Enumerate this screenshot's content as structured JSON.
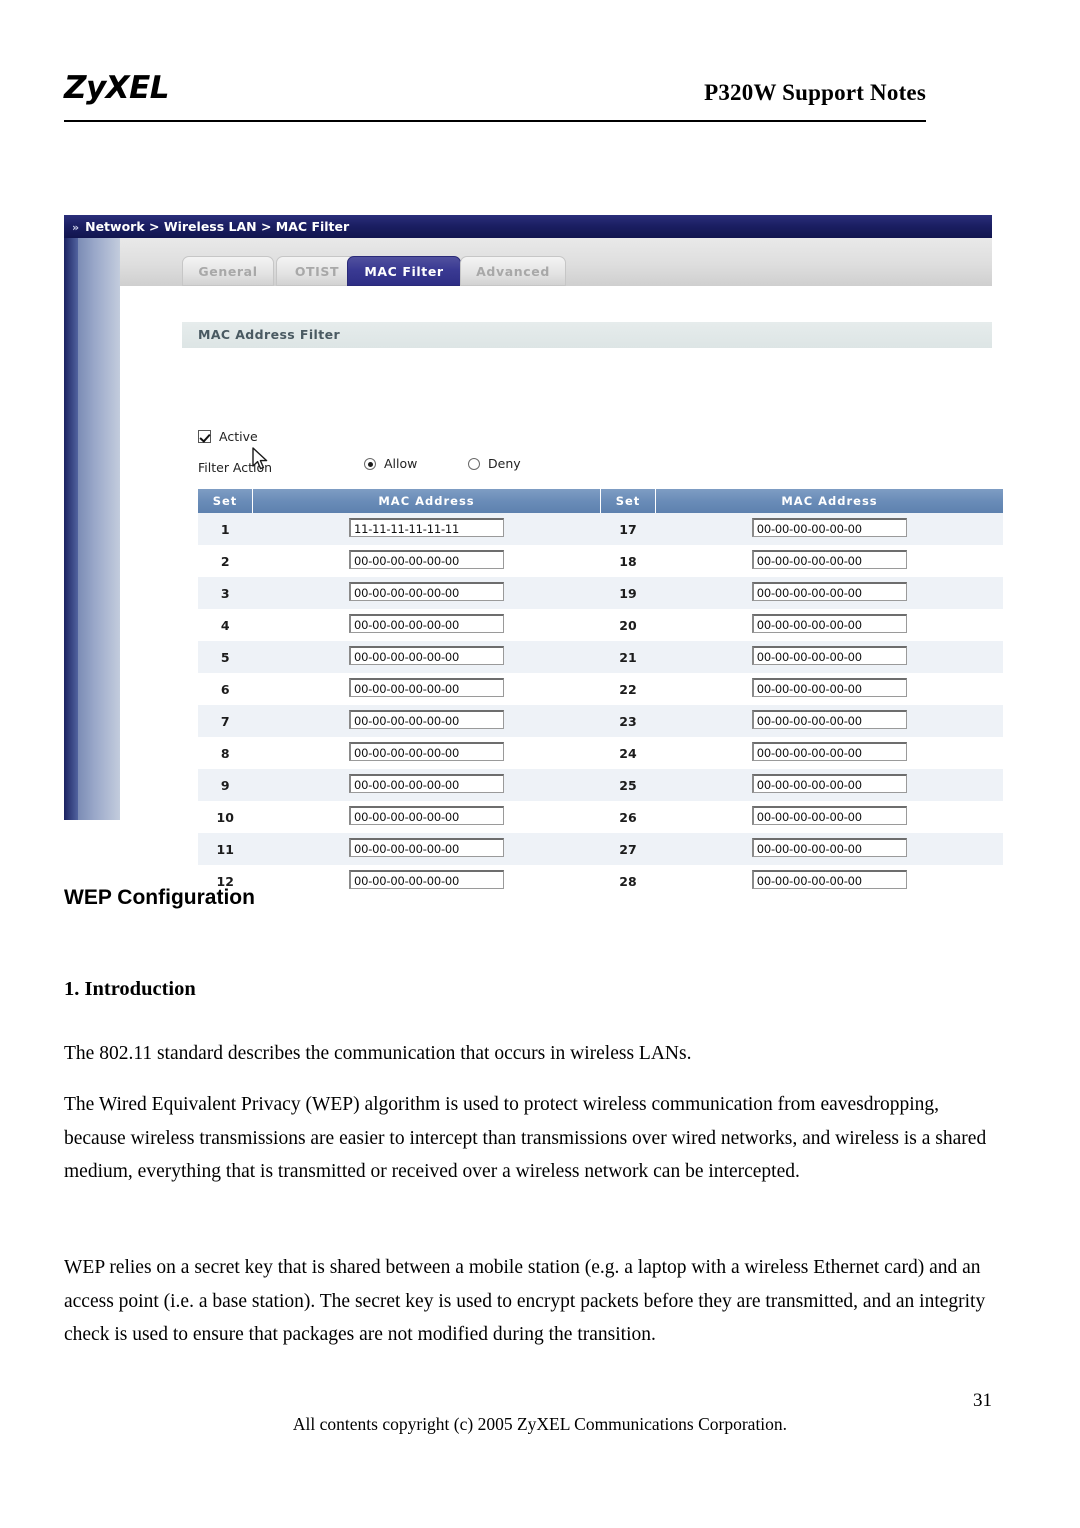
{
  "page": {
    "logo_text": "ZyXEL",
    "header_title": "P320W Support Notes",
    "page_number": "31",
    "footer_copyright": "All contents copyright (c) 2005 ZyXEL Communications Corporation."
  },
  "router_ui": {
    "breadcrumb": "Network > Wireless LAN > MAC Filter",
    "breadcrumb_arrow": "»",
    "tabs": [
      {
        "label": "General",
        "active": false
      },
      {
        "label": "OTIST",
        "active": false
      },
      {
        "label": "MAC Filter",
        "active": true
      },
      {
        "label": "Advanced",
        "active": false
      }
    ],
    "section_title": "MAC Address Filter",
    "active_checkbox": {
      "label": "Active",
      "checked": true
    },
    "filter_action": {
      "label": "Filter Action",
      "options": [
        {
          "label": "Allow",
          "selected": true
        },
        {
          "label": "Deny",
          "selected": false
        }
      ]
    },
    "table": {
      "headers": [
        "Set",
        "MAC Address",
        "Set",
        "MAC Address"
      ],
      "rows": [
        {
          "set_left": "1",
          "mac_left": "11-11-11-11-11-11",
          "set_right": "17",
          "mac_right": "00-00-00-00-00-00"
        },
        {
          "set_left": "2",
          "mac_left": "00-00-00-00-00-00",
          "set_right": "18",
          "mac_right": "00-00-00-00-00-00"
        },
        {
          "set_left": "3",
          "mac_left": "00-00-00-00-00-00",
          "set_right": "19",
          "mac_right": "00-00-00-00-00-00"
        },
        {
          "set_left": "4",
          "mac_left": "00-00-00-00-00-00",
          "set_right": "20",
          "mac_right": "00-00-00-00-00-00"
        },
        {
          "set_left": "5",
          "mac_left": "00-00-00-00-00-00",
          "set_right": "21",
          "mac_right": "00-00-00-00-00-00"
        },
        {
          "set_left": "6",
          "mac_left": "00-00-00-00-00-00",
          "set_right": "22",
          "mac_right": "00-00-00-00-00-00"
        },
        {
          "set_left": "7",
          "mac_left": "00-00-00-00-00-00",
          "set_right": "23",
          "mac_right": "00-00-00-00-00-00"
        },
        {
          "set_left": "8",
          "mac_left": "00-00-00-00-00-00",
          "set_right": "24",
          "mac_right": "00-00-00-00-00-00"
        },
        {
          "set_left": "9",
          "mac_left": "00-00-00-00-00-00",
          "set_right": "25",
          "mac_right": "00-00-00-00-00-00"
        },
        {
          "set_left": "10",
          "mac_left": "00-00-00-00-00-00",
          "set_right": "26",
          "mac_right": "00-00-00-00-00-00"
        },
        {
          "set_left": "11",
          "mac_left": "00-00-00-00-00-00",
          "set_right": "27",
          "mac_right": "00-00-00-00-00-00"
        },
        {
          "set_left": "12",
          "mac_left": "00-00-00-00-00-00",
          "set_right": "28",
          "mac_right": "00-00-00-00-00-00"
        }
      ]
    },
    "colors": {
      "breadcrumb_bar": "#1b1f63",
      "active_tab": "#3a3a93",
      "inactive_tab": "#e3e3e3",
      "table_header": "#6a8cb8",
      "row_alt": "#eef2f7",
      "section_title_bar": "#dde5e5"
    }
  },
  "content": {
    "heading_wep": "WEP Configuration",
    "heading_intro": "1. Introduction",
    "paragraph_1": "The 802.11 standard describes the communication that occurs in wireless LANs.",
    "paragraph_2": "The Wired Equivalent Privacy (WEP) algorithm is used to protect wireless communication from eavesdropping, because wireless transmissions are easier to intercept than transmissions over wired networks, and wireless is a shared medium, everything that is transmitted or received over a wireless network can be intercepted.",
    "paragraph_3": "WEP relies on a secret key that is shared between a mobile station (e.g. a laptop with a wireless Ethernet card) and an access point (i.e. a base station). The secret key is used to encrypt packets before they are transmitted, and an integrity check is used to ensure that packages are not modified during the transition."
  }
}
